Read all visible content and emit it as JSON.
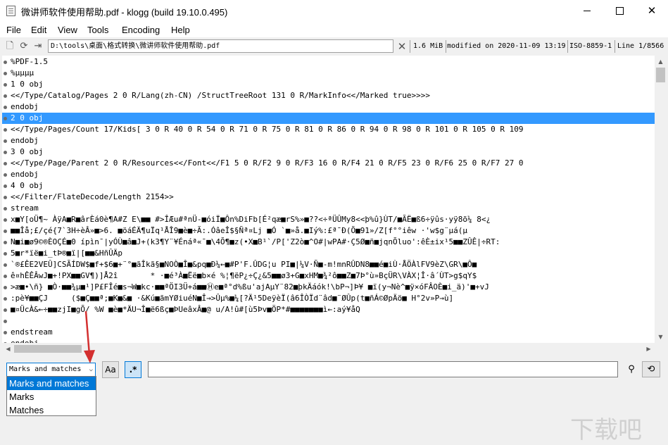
{
  "window": {
    "title": "微讲师软件使用帮助.pdf - klogg (build 19.10.0.495)"
  },
  "menu": [
    "File",
    "Edit",
    "View",
    "Tools",
    "Encoding",
    "Help"
  ],
  "toolbar": {
    "path": "D:\\tools\\桌面\\格式转换\\微讲师软件使用帮助.pdf",
    "size": "1.6 MiB",
    "modified": "modified on 2020-11-09 13:19",
    "encoding": "ISO-8859-1",
    "line": "Line 1/8566"
  },
  "icons": {
    "app": "document-icon",
    "open": "open-file-icon",
    "reload": "reload-icon",
    "follow": "follow-icon",
    "close_file": "close-file-icon"
  },
  "lines": [
    "%PDF-1.5",
    "%µµµµ",
    "1 0 obj",
    "<</Type/Catalog/Pages 2 0 R/Lang(zh-CN) /StructTreeRoot 131 0 R/MarkInfo<</Marked true>>>>",
    "endobj",
    "2 0 obj",
    "<</Type/Pages/Count 17/Kids[ 3 0 R 40 0 R 54 0 R 71 0 R 75 0 R 81 0 R 86 0 R 94 0 R 98 0 R 101 0 R 105 0 R 109",
    "endobj",
    "3 0 obj",
    "<</Type/Page/Parent 2 0 R/Resources<</Font<</F1 5 0 R/F2 9 0 R/F3 16 0 R/F4 21 0 R/F5 23 0 R/F6 25 0 R/F7 27 0",
    "endobj",
    "4 0 obj",
    "<</Filter/FlateDecode/Length 2154>>",
    "stream",
    "x■Y[oÜ¶~ ÀÿA■R■ârÈá0è¶A#Z E\\■■ #>ÎÆu#ªnÜ-■óiÏ■Ôn%DiFb[É²qæ■rS%»■??<÷ªÜÛMy8<<þ%û}ÙT/■ÃË■ß6÷ÿûs·yÿ8õ¼ 8<¿",
    "■■Îå;£/çé{7`3H÷èÂ»■>6. ■öáÉÄ¶uÏq¹ÅÎ9■è■÷Ã:.ÓâeÎ$§Ñª¤Lj ■Ó `■»å.■Iý%:£ª¯Ð(Õ■91»/Z[f°°iêw ·'w$g¨µá(µ",
    "N■i■ø9©®ÈOÇÉ■0 ípìn¯|yÓÙ■â■J+(k3¶Y¨¥Énáª«¯■\\4Õ¶■z(•X■B¹`/P['Z2ò■^O#|wPA#·Ç5Ø■ñ■jqnÕluo':êÈ±ix¹5■■ZÛÊ|÷RT:",
    "5■r*ïë■i_tÞ®■ï|[■■&HñÛÄp",
    "`®£ÊE2VEÛ]CSÃÍDW$■f+$6■+¨°■ãÎkã§■NOÒ■Î■&pq■Ð¼←■#P'F.ÛDG¦u PI■|¼V·Ñ■-m!mnRÛDN8■■é■iÙ·ÅÖÀlFV9èZ\\GR\\■Ô■",
    "ê¤hÊÊÂwJ■+!PX■■GV¶)]Å2î       * ·■é³À■Ëë■b×é %¦¶ëP¿÷Ç¿&5■■ø3+G■xHM■¾²ô■■Z■7Þ°ù»BçÜR\\VÀX¦Î·â´ÙT>g$qY$",
    ">æ■•\\ñ} ■Ò·■■¾µ■¹]P£FÎé■s¬W■kc·■■ªÖI3Ü+á■■Ⓗe■ª°d%ßu'ajAµY¨82■þkÄáók!\\bP¬]Þ¥ ■ï(y¬Nè^■ÿ×óFÂOÈ■i_ä)'■+vJ",
    ":pè¥■■ÇJ     ($■Ç■■ª;■K■&■ ·&Kú■ãmYØiuéN■Î→>Ûµ%■¼[?Ä¹5DeÿèÏ(â6ÎÒÏd¨âd■¨ØÛp(t■ñÁ©ØpÄö■ H°2v»P→ù]",
    "■¤ÜcÀ&←÷■■zjI■gÕ/ %W ■è■*ÄU¬Î■ë6ßç■ÞUeâxÂ■@ u/A!û#[ù5Þv■ÖP*#■■■■■■■ì←:aý¥åQ",
    "",
    "endstream",
    "endobj"
  ],
  "selected_line": 5,
  "search": {
    "mode": "Marks and matches",
    "options": [
      "Marks and matches",
      "Marks",
      "Matches"
    ],
    "case_label": "Aa",
    "regex_label": ".*",
    "query": "",
    "find_icon": "search-icon",
    "refresh_icon": "refresh-icon"
  },
  "watermark": "下载吧",
  "colors": {
    "selection": "#3399ff",
    "arrow": "#d32f2f",
    "accent": "#0078d7"
  }
}
